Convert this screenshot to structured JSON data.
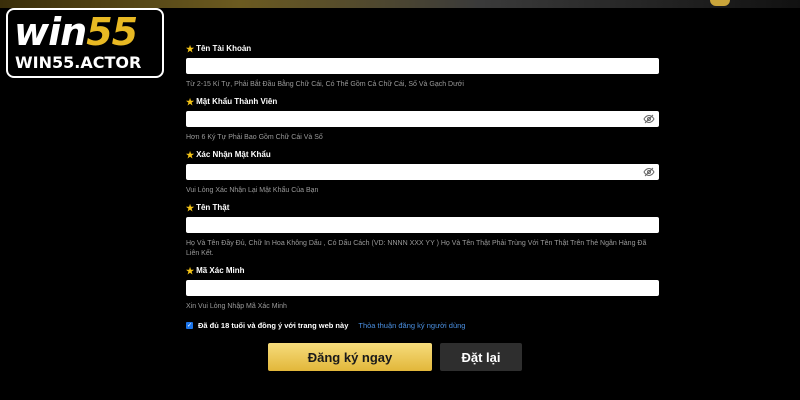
{
  "logo": {
    "big_part1": "win",
    "big_part2": "55",
    "small": "WIN55.ACTOR"
  },
  "fields": [
    {
      "label": "Tên Tài Khoản",
      "value": "",
      "hint": "Từ 2-15 Kí Tự, Phải Bắt Đầu Bằng Chữ Cái, Có Thể Gồm Cả Chữ Cái, Số Và Gạch Dưới"
    },
    {
      "label": "Mật Khẩu Thành Viên",
      "value": "",
      "hint": "Hơn 6 Ký Tự Phải Bao Gồm Chữ Cái Và Số"
    },
    {
      "label": "Xác Nhận Mật Khẩu",
      "value": "",
      "hint": "Vui Lòng Xác Nhận Lại Mật Khẩu Của Bạn"
    },
    {
      "label": "Tên Thật",
      "value": "",
      "hint": "Họ Và Tên Đầy Đủ, Chữ In Hoa Không Dấu , Có Dấu Cách (VD: NNNN XXX YY ) Họ Và Tên Thật Phải Trùng Với Tên Thật Trên Thẻ Ngân Hàng Đã Liên Kết."
    },
    {
      "label": "Mã Xác Minh",
      "value": "",
      "hint": "Xin Vui Lòng Nhập Mã Xác Minh"
    }
  ],
  "agree": {
    "checked": true,
    "text": "Đã đủ 18 tuổi và đồng ý với trang web này",
    "link": "Thỏa thuận đăng ký người dùng"
  },
  "buttons": {
    "register": "Đăng ký ngay",
    "reset": "Đặt lại"
  },
  "colors": {
    "accent_gold": "#e8b923",
    "link_blue": "#4a8fe0"
  },
  "icons": {
    "required": "star-icon",
    "toggle_password": "eye-slash-icon"
  }
}
